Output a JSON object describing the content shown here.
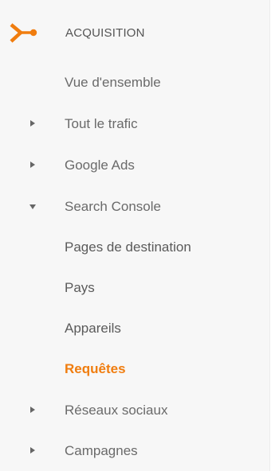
{
  "section": {
    "title": "ACQUISITION",
    "icon": "acquisition-icon",
    "accent_color": "#f07d0f"
  },
  "items": [
    {
      "label": "Vue d'ensemble",
      "expander": "none"
    },
    {
      "label": "Tout le trafic",
      "expander": "collapsed"
    },
    {
      "label": "Google Ads",
      "expander": "collapsed"
    },
    {
      "label": "Search Console",
      "expander": "expanded"
    },
    {
      "label": "Pages de destination",
      "expander": "none"
    },
    {
      "label": "Pays",
      "expander": "none"
    },
    {
      "label": "Appareils",
      "expander": "none"
    },
    {
      "label": "Requêtes",
      "expander": "none",
      "active": true
    },
    {
      "label": "Réseaux sociaux",
      "expander": "collapsed"
    },
    {
      "label": "Campagnes",
      "expander": "collapsed"
    }
  ]
}
